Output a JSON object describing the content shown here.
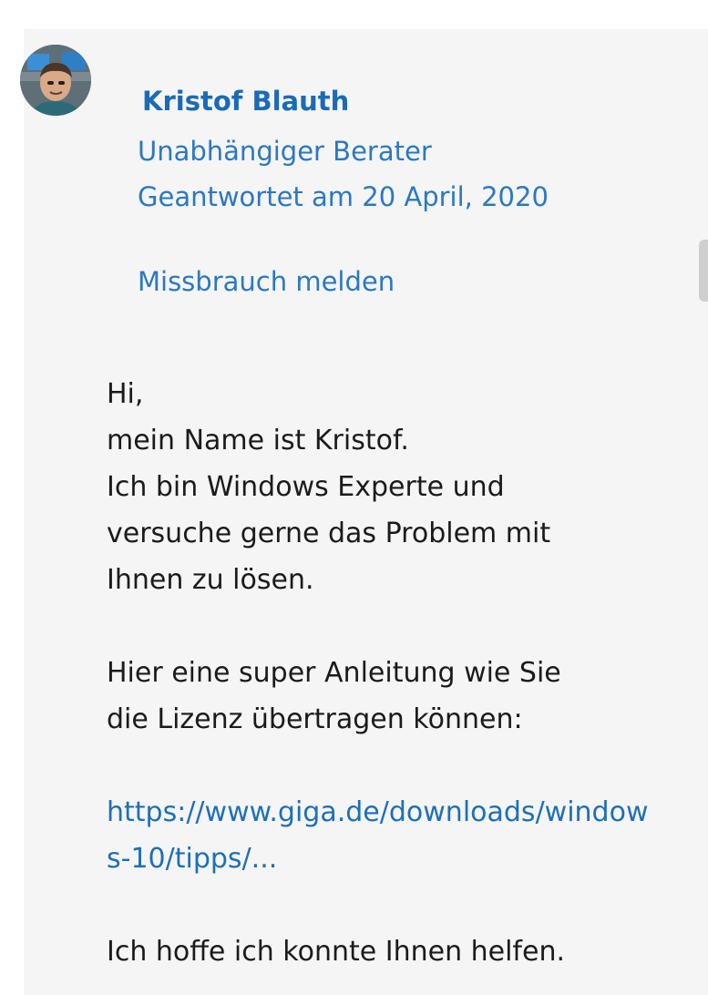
{
  "author": {
    "name": "Kristof Blauth",
    "role": "Unabhängiger Berater",
    "answered": "Geantwortet am 20 April, 2020",
    "report_label": "Missbrauch melden"
  },
  "post": {
    "greeting": "Hi,\nmein Name ist Kristof.\nIch bin Windows Experte und\nversuche gerne das Problem mit\nIhnen zu lösen.",
    "intro": "Hier eine super Anleitung wie Sie\ndie Lizenz übertragen können:",
    "link_text": "https://www.giga.de/downloads/windows-10/tipps/...",
    "closing": "Ich hoffe ich konnte Ihnen helfen."
  },
  "colors": {
    "name": "#1a6bb7",
    "meta": "#2b78c2",
    "link": "#1e6fb8",
    "card_background": "#f5f5f5"
  }
}
